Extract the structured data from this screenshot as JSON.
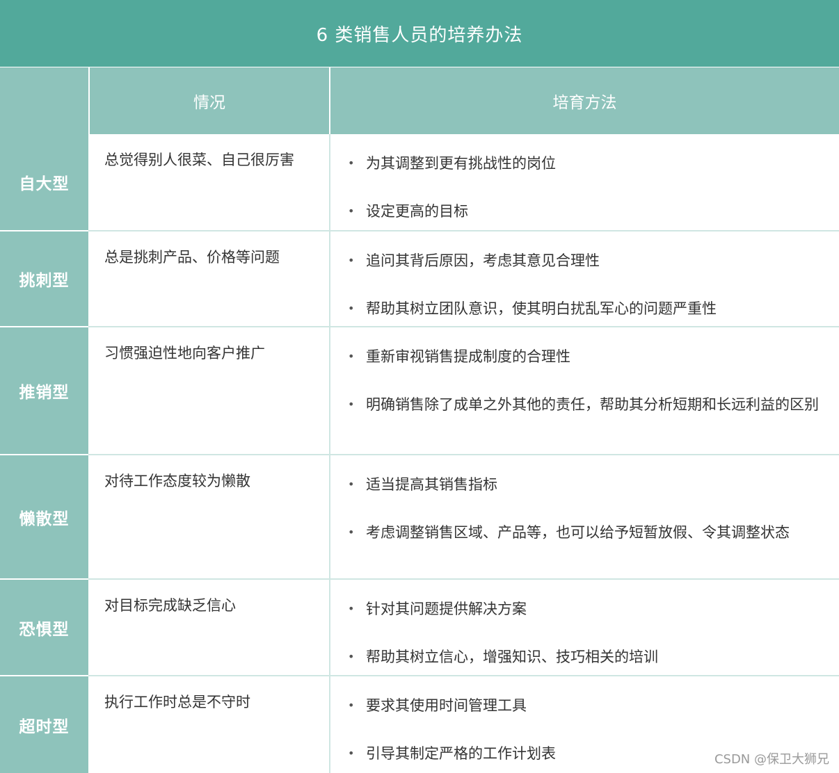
{
  "title": "6 类销售人员的培养办法",
  "headers": {
    "type": "",
    "situation": "情况",
    "method": "培育方法"
  },
  "bullet": "•",
  "rows": [
    {
      "type": "自大型",
      "situation": "总觉得别人很菜、自己很厉害",
      "methods": [
        "为其调整到更有挑战性的岗位",
        "设定更高的目标"
      ]
    },
    {
      "type": "挑刺型",
      "situation": "总是挑刺产品、价格等问题",
      "methods": [
        "追问其背后原因，考虑其意见合理性",
        "帮助其树立团队意识，使其明白扰乱军心的问题严重性"
      ]
    },
    {
      "type": "推销型",
      "situation": "习惯强迫性地向客户推广",
      "methods": [
        "重新审视销售提成制度的合理性",
        "明确销售除了成单之外其他的责任，帮助其分析短期和长远利益的区别"
      ]
    },
    {
      "type": "懒散型",
      "situation": "对待工作态度较为懒散",
      "methods": [
        "适当提高其销售指标",
        "考虑调整销售区域、产品等，也可以给予短暂放假、令其调整状态"
      ]
    },
    {
      "type": "恐惧型",
      "situation": "对目标完成缺乏信心",
      "methods": [
        "针对其问题提供解决方案",
        "帮助其树立信心，增强知识、技巧相关的培训"
      ]
    },
    {
      "type": "超时型",
      "situation": "执行工作时总是不守时",
      "methods": [
        "要求其使用时间管理工具",
        "引导其制定严格的工作计划表"
      ]
    }
  ],
  "watermark": "CSDN @保卫大狮兄",
  "colors": {
    "title_bg": "#52a99b",
    "header_bg": "#8ec3bb",
    "grid": "#cfe6e2",
    "text": "#333333"
  }
}
